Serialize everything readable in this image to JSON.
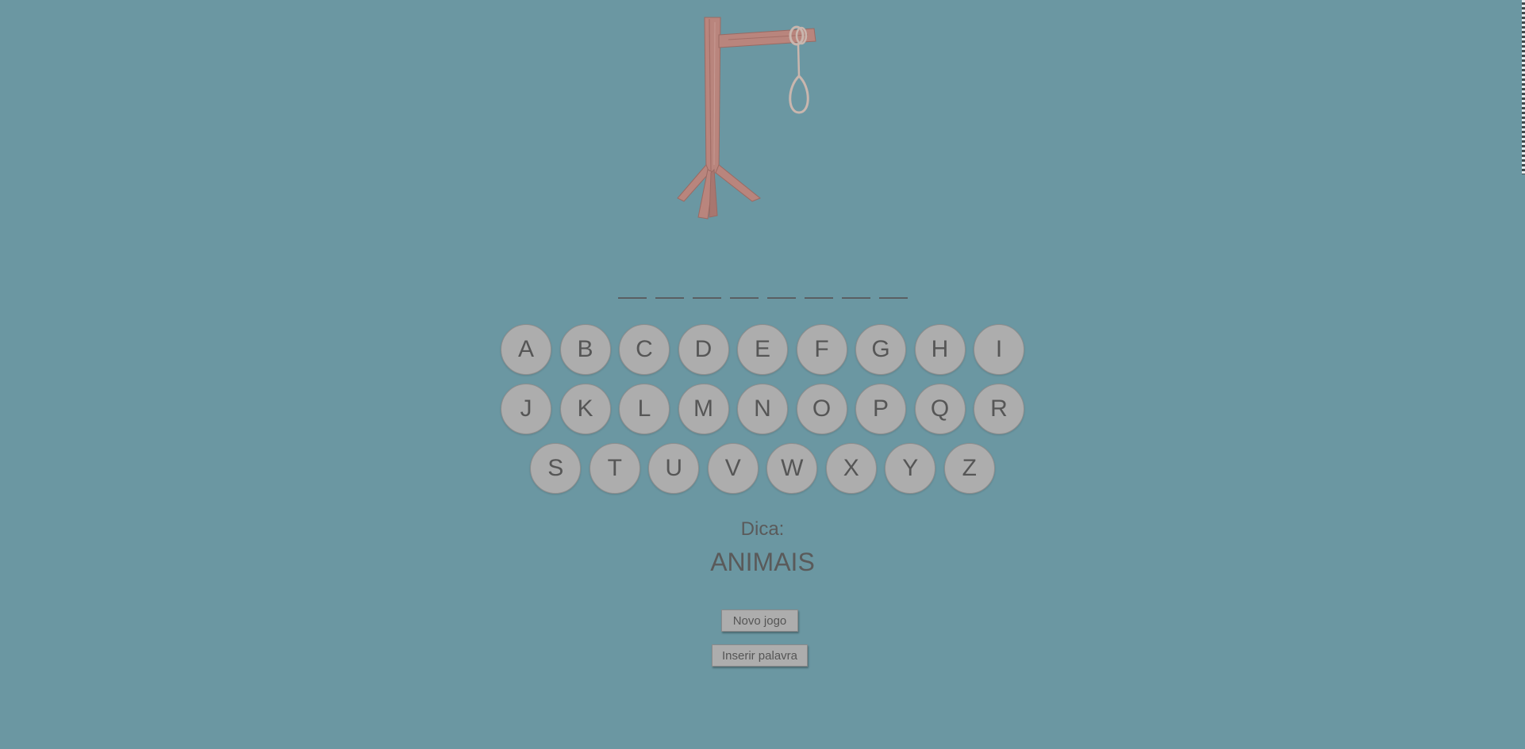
{
  "game": {
    "word_length": 8,
    "keyboard_rows": [
      [
        "A",
        "B",
        "C",
        "D",
        "E",
        "F",
        "G",
        "H",
        "I"
      ],
      [
        "J",
        "K",
        "L",
        "M",
        "N",
        "O",
        "P",
        "Q",
        "R"
      ],
      [
        "S",
        "T",
        "U",
        "V",
        "W",
        "X",
        "Y",
        "Z"
      ]
    ],
    "hint_label": "Dica:",
    "hint_value": "ANIMAIS"
  },
  "actions": {
    "new_game_label": "Novo jogo",
    "insert_word_label": "Inserir palavra"
  },
  "colors": {
    "background": "#6b97a2",
    "key_fill": "#adadad",
    "text": "#565656",
    "wood": "#b9857d"
  }
}
